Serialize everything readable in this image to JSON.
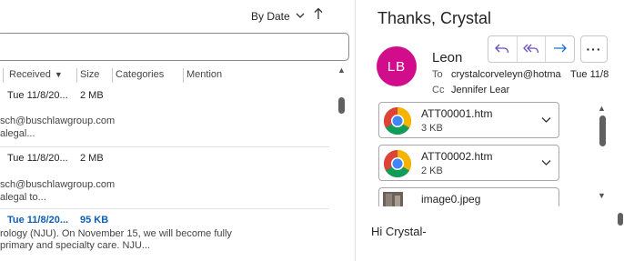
{
  "list": {
    "sort_label": "By Date",
    "columns": [
      "Received",
      "Size",
      "Categories",
      "Mention"
    ],
    "rows": [
      {
        "date": "Tue 11/8/20...",
        "size": "2 MB",
        "line1": "sch@buschlawgroup.com",
        "line2": "alegal...",
        "unread": false
      },
      {
        "date": "Tue 11/8/20...",
        "size": "2 MB",
        "line1": "sch@buschlawgroup.com",
        "line2": "alegal to...",
        "unread": false
      },
      {
        "date": "Tue 11/8/20...",
        "size": "95 KB",
        "line1": "rology (NJU). On November 15, we will become fully",
        "line2": " primary and specialty care.  NJU...",
        "unread": true
      }
    ]
  },
  "reading": {
    "subject": "Thanks, Crystal",
    "avatar_initials": "LB",
    "avatar_color": "#d10d8c",
    "sender": "Leon",
    "to_label": "To",
    "to_value": "crystalcorveleyn@hotma",
    "date": "Tue 11/8",
    "cc_label": "Cc",
    "cc_value": "Jennifer Lear",
    "attachments": [
      {
        "name": "ATT00001.htm",
        "size": "3 KB",
        "icon": "chrome-icon"
      },
      {
        "name": "ATT00002.htm",
        "size": "2 KB",
        "icon": "chrome-icon"
      },
      {
        "name": "image0.jpeg",
        "size": "",
        "icon": "image-thumbnail"
      }
    ],
    "body": "Hi Crystal-"
  },
  "colors": {
    "accent": "#0f5fb5",
    "action_icon": "#6b4fbb",
    "forward_icon": "#1a73c7"
  }
}
